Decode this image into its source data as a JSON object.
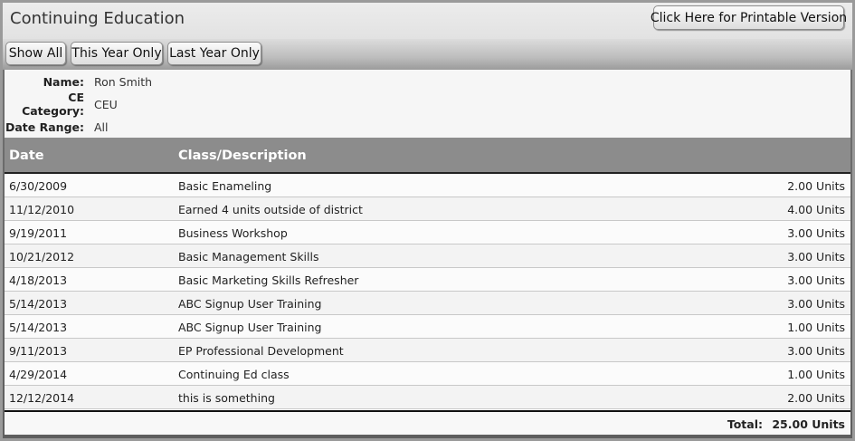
{
  "header": {
    "title": "Continuing Education",
    "print_button": "Click Here for Printable Version"
  },
  "filters": {
    "show_all": "Show All",
    "this_year": "This Year Only",
    "last_year": "Last Year Only"
  },
  "info": {
    "name_label": "Name:",
    "name_value": "Ron Smith",
    "category_label": "CE Category:",
    "category_value": "CEU",
    "range_label": "Date Range:",
    "range_value": "All"
  },
  "table": {
    "columns": [
      "Date",
      "Class/Description"
    ],
    "rows": [
      {
        "date": "6/30/2009",
        "desc": "Basic Enameling",
        "units": "2.00 Units"
      },
      {
        "date": "11/12/2010",
        "desc": "Earned 4 units outside of district",
        "units": "4.00 Units"
      },
      {
        "date": "9/19/2011",
        "desc": "Business Workshop",
        "units": "3.00 Units"
      },
      {
        "date": "10/21/2012",
        "desc": "Basic Management Skills",
        "units": "3.00 Units"
      },
      {
        "date": "4/18/2013",
        "desc": "Basic Marketing Skills Refresher",
        "units": "3.00 Units"
      },
      {
        "date": "5/14/2013",
        "desc": "ABC Signup User Training",
        "units": "3.00 Units"
      },
      {
        "date": "5/14/2013",
        "desc": "ABC Signup User Training",
        "units": "1.00 Units"
      },
      {
        "date": "9/11/2013",
        "desc": "EP Professional Development",
        "units": "3.00 Units"
      },
      {
        "date": "4/29/2014",
        "desc": "Continuing Ed class",
        "units": "1.00 Units"
      },
      {
        "date": "12/12/2014",
        "desc": "this is something",
        "units": "2.00 Units"
      }
    ],
    "total_label": "Total:",
    "total_value": "25.00 Units"
  }
}
